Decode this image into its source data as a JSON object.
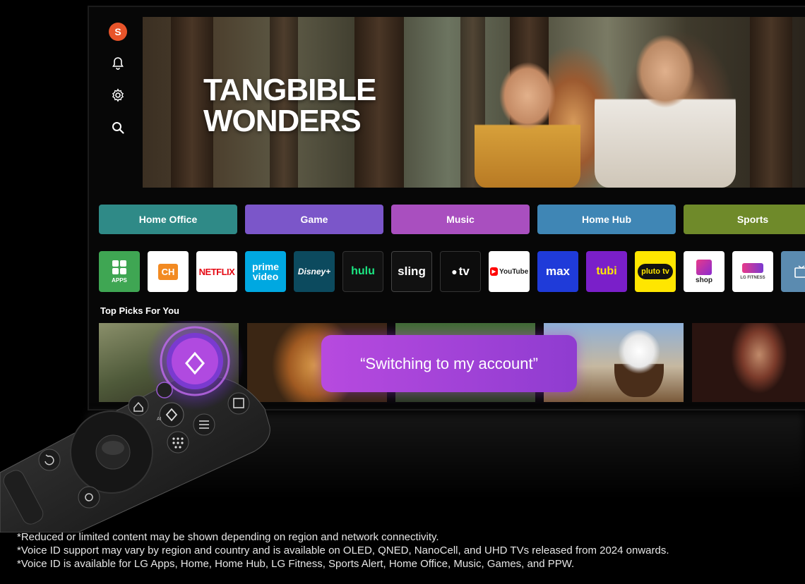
{
  "sidebar": {
    "avatar_letter": "S",
    "icons": [
      "bell-icon",
      "gear-icon",
      "search-icon"
    ]
  },
  "hero": {
    "title_line1": "TANGBIBLE",
    "title_line2": "WONDERS"
  },
  "categories": [
    {
      "label": "Home Office",
      "color": "#2f8a87"
    },
    {
      "label": "Game",
      "color": "#7b56c9"
    },
    {
      "label": "Music",
      "color": "#a94fbf"
    },
    {
      "label": "Home Hub",
      "color": "#3f86b5"
    },
    {
      "label": "Sports",
      "color": "#6f8a2a"
    }
  ],
  "apps": [
    {
      "label": "APPS"
    },
    {
      "label": "CH"
    },
    {
      "label": "NETFLIX"
    },
    {
      "label": "prime video"
    },
    {
      "label": "Disney+"
    },
    {
      "label": "hulu"
    },
    {
      "label": "sling"
    },
    {
      "label": "tv"
    },
    {
      "label": "YouTube"
    },
    {
      "label": "max"
    },
    {
      "label": "tubi"
    },
    {
      "label": "pluto tv"
    },
    {
      "label": "shop"
    },
    {
      "label": "LG FITNESS"
    },
    {
      "label": ""
    }
  ],
  "section": {
    "top_picks": "Top Picks For You"
  },
  "voice_bubble": "“Switching to my account”",
  "remote": {
    "ai_label": "AI"
  },
  "footnotes": [
    "*Reduced or limited content may be shown depending on region and network connectivity.",
    "*Voice ID support may vary by region and country and is available on OLED, QNED, NanoCell, and UHD TVs released from 2024 onwards.",
    "*Voice ID is available for LG Apps, Home, Home Hub, LG Fitness, Sports Alert, Home Office, Music, Games, and PPW."
  ]
}
